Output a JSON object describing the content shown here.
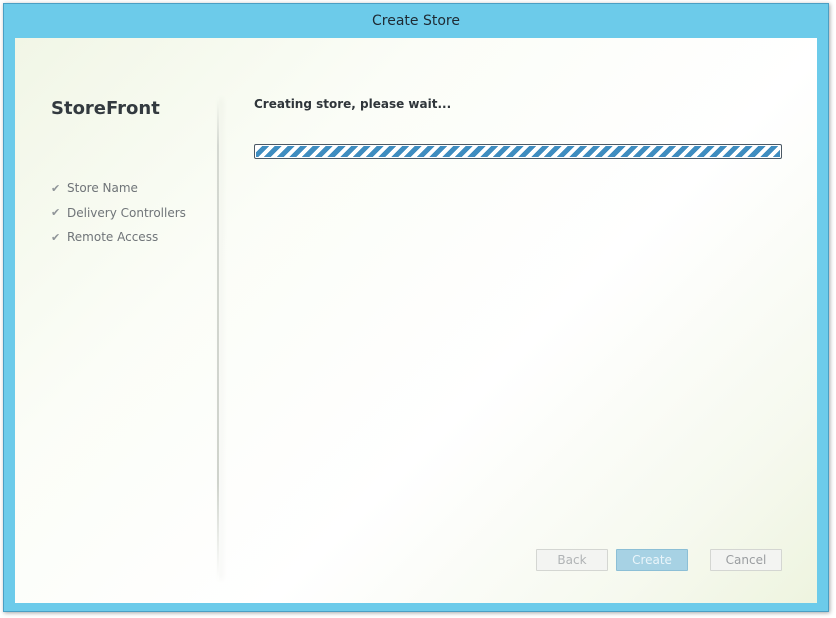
{
  "window": {
    "title": "Create Store"
  },
  "sidebar": {
    "brand": "StoreFront",
    "steps": [
      {
        "label": "Store Name",
        "icon": "checkmark-icon"
      },
      {
        "label": "Delivery Controllers",
        "icon": "checkmark-icon"
      },
      {
        "label": "Remote Access",
        "icon": "checkmark-icon"
      }
    ]
  },
  "main": {
    "status": "Creating store, please wait...",
    "progress": {
      "state": "indeterminate",
      "color": "#3f8dc0"
    }
  },
  "buttons": {
    "back": "Back",
    "create": "Create",
    "cancel": "Cancel"
  },
  "colors": {
    "titlebar": "#6ccbea",
    "primary_button": "#a7d2e4"
  }
}
